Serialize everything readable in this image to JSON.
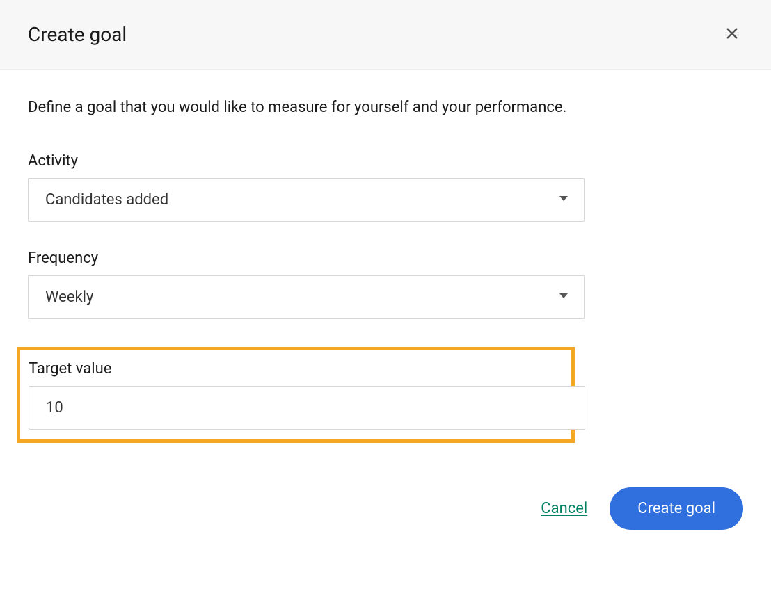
{
  "dialog": {
    "title": "Create goal",
    "description": "Define a goal that you would like to measure for yourself and your performance."
  },
  "form": {
    "activity": {
      "label": "Activity",
      "value": "Candidates added"
    },
    "frequency": {
      "label": "Frequency",
      "value": "Weekly"
    },
    "target": {
      "label": "Target value",
      "value": "10"
    }
  },
  "footer": {
    "cancel": "Cancel",
    "submit": "Create goal"
  }
}
